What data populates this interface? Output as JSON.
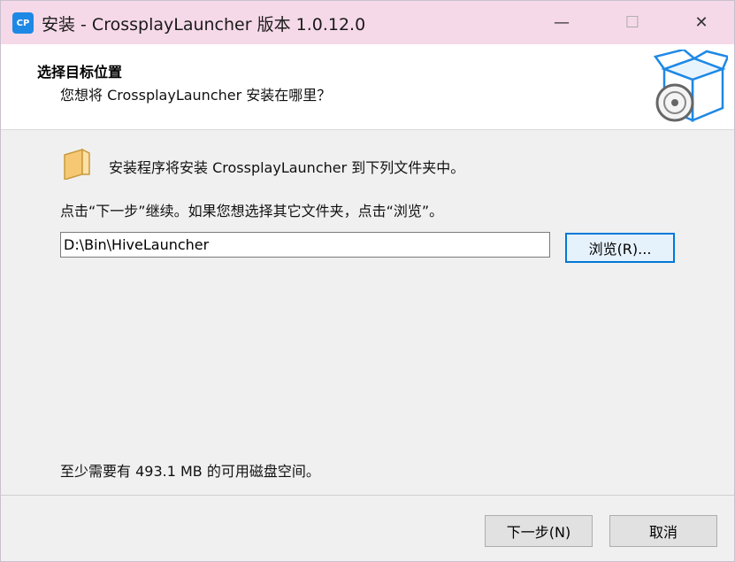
{
  "window": {
    "title": "安装 - CrossplayLauncher 版本 1.0.12.0",
    "app_icon_text": "CP",
    "controls": {
      "minimize": "—",
      "maximize": "☐",
      "close": "✕"
    }
  },
  "header": {
    "title": "选择目标位置",
    "subtitle": "您想将 CrossplayLauncher 安装在哪里？"
  },
  "body": {
    "intro": "安装程序将安装 CrossplayLauncher 到下列文件夹中。",
    "instruction": "点击“下一步”继续。如果您想选择其它文件夹，点击“浏览”。",
    "path_value": "D:\\Bin\\HiveLauncher",
    "browse_label": "浏览(R)...",
    "disk_space": "至少需要有 493.1 MB 的可用磁盘空间。"
  },
  "footer": {
    "next_label": "下一步(N)",
    "cancel_label": "取消"
  },
  "colors": {
    "titlebar": "#f6d9e8",
    "accent": "#0078d7",
    "app_icon": "#1e88e5"
  }
}
